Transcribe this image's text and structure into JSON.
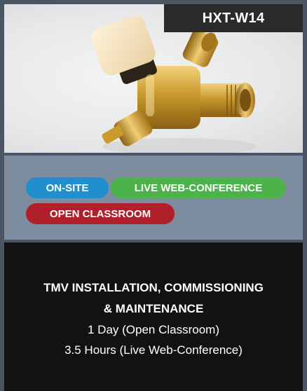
{
  "course": {
    "code": "HXT-W14",
    "title_line1": "TMV INSTALLATION, COMMISSIONING",
    "title_line2": "& MAINTENANCE",
    "duration_classroom": "1 Day (Open Classroom)",
    "duration_web": "3.5 Hours (Live Web-Conference)"
  },
  "delivery_tags": [
    {
      "label": "ON-SITE",
      "color": "#1f8fce"
    },
    {
      "label": "LIVE WEB-CONFERENCE",
      "color": "#4bb34a"
    },
    {
      "label": "OPEN CLASSROOM",
      "color": "#b0202a"
    }
  ],
  "image": {
    "icon": "brass-valve-image"
  },
  "colors": {
    "page_bg": "#4b5563",
    "tags_bg": "#7d8d9f",
    "info_bg": "#121212",
    "code_tag_bg": "#2a2a2a"
  }
}
